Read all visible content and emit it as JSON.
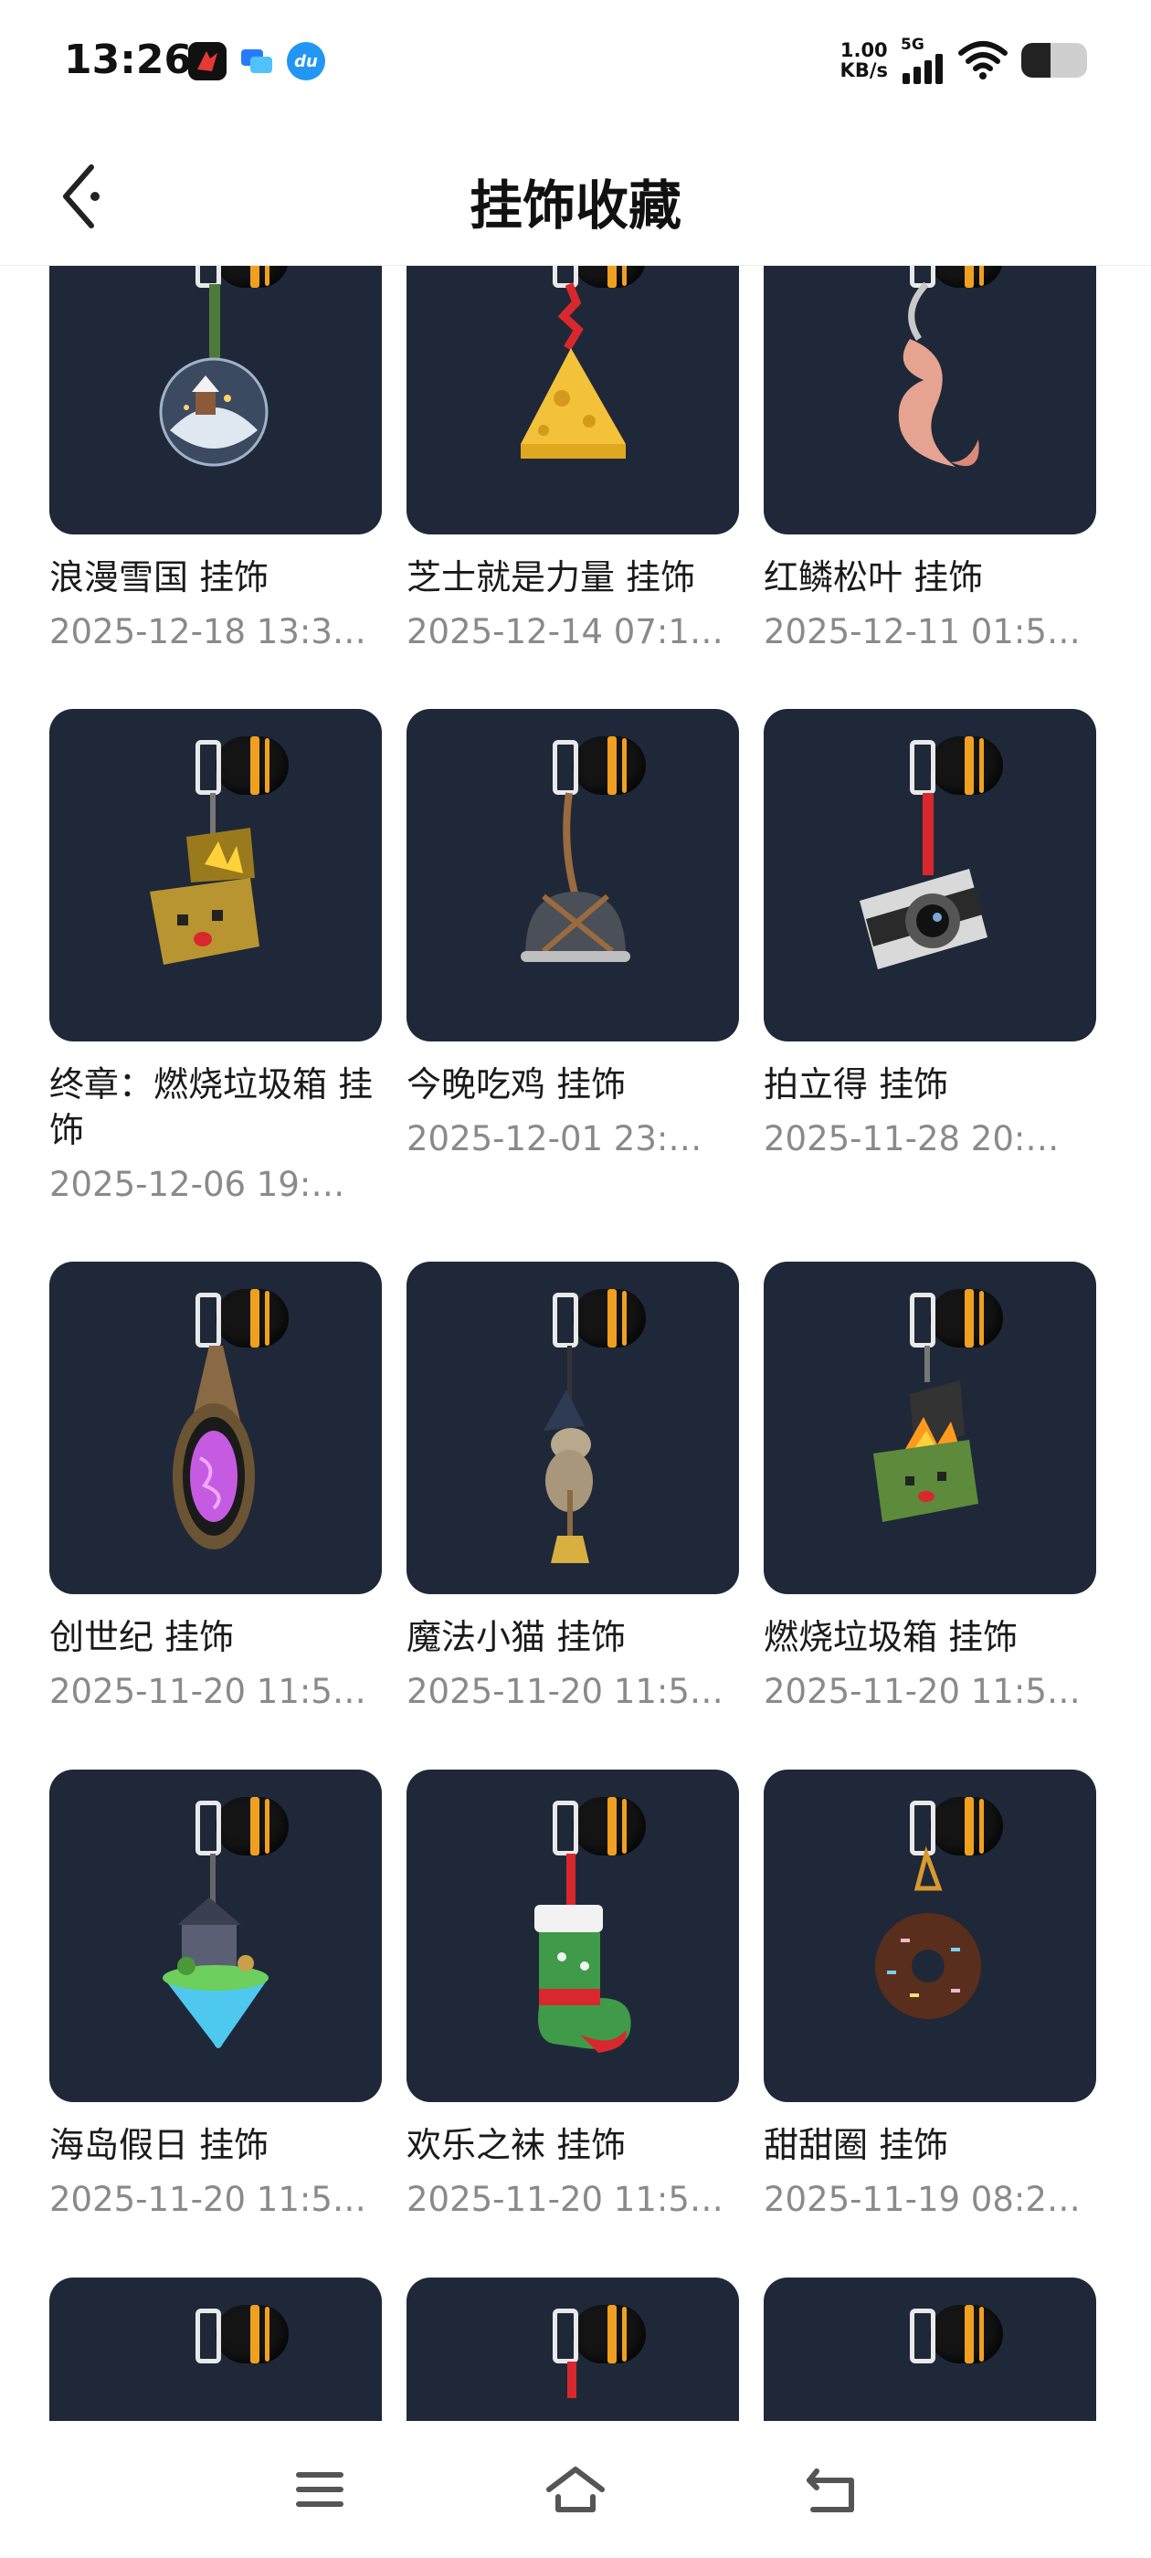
{
  "status_bar": {
    "time": "13:26",
    "net_speed_value": "1.00",
    "net_speed_unit": "KB/s",
    "signal_label": "5G",
    "battery_level_percent": 45,
    "app_icons": [
      "red-app-icon",
      "chat-app-icon",
      "du-app-icon"
    ],
    "du_label": "du"
  },
  "header": {
    "title": "挂饰收藏",
    "back_icon": "back-arrow-icon"
  },
  "colors": {
    "thumb_bg": "#1f2838",
    "date_text": "#8a8a8a",
    "accent_band": "#f0a020"
  },
  "charms": [
    {
      "name": "浪漫雪国 挂饰",
      "date": "2025-12-18 13:3…",
      "icon": "snow-globe-charm-icon"
    },
    {
      "name": "芝士就是力量 挂饰",
      "date": "2025-12-14 07:1…",
      "icon": "cheese-charm-icon"
    },
    {
      "name": "红鳞松叶 挂饰",
      "date": "2025-12-11 01:5…",
      "icon": "koi-fish-charm-icon"
    },
    {
      "name": "终章：燃烧垃圾箱 挂饰",
      "date": "2025-12-06 19:…",
      "icon": "burning-chest-charm-icon"
    },
    {
      "name": "今晚吃鸡 挂饰",
      "date": "2025-12-01 23:…",
      "icon": "helmet-charm-icon"
    },
    {
      "name": "拍立得 挂饰",
      "date": "2025-11-28 20:…",
      "icon": "camera-charm-icon"
    },
    {
      "name": "创世纪 挂饰",
      "date": "2025-11-20 11:5…",
      "icon": "crystal-pendant-charm-icon"
    },
    {
      "name": "魔法小猫 挂饰",
      "date": "2025-11-20 11:5…",
      "icon": "witch-cat-charm-icon"
    },
    {
      "name": "燃烧垃圾箱 挂饰",
      "date": "2025-11-20 11:5…",
      "icon": "burning-dumpster-charm-icon"
    },
    {
      "name": "海岛假日 挂饰",
      "date": "2025-11-20 11:5…",
      "icon": "floating-island-charm-icon"
    },
    {
      "name": "欢乐之袜 挂饰",
      "date": "2025-11-20 11:5…",
      "icon": "christmas-stocking-charm-icon"
    },
    {
      "name": "甜甜圈 挂饰",
      "date": "2025-11-19 08:2…",
      "icon": "donut-charm-icon"
    },
    {
      "name": "",
      "date": "",
      "icon": "partial-charm-icon"
    },
    {
      "name": "",
      "date": "",
      "icon": "partial-charm-icon"
    },
    {
      "name": "",
      "date": "",
      "icon": "partial-charm-icon"
    }
  ],
  "bottom_nav": {
    "menu_icon": "menu-icon",
    "home_icon": "home-icon",
    "back_icon": "back-nav-icon"
  }
}
